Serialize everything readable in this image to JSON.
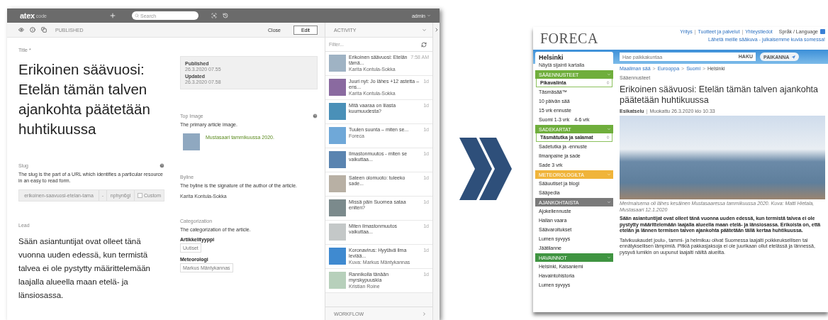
{
  "editor": {
    "topbar": {
      "logo": "atex",
      "logo_suffix": "code",
      "search_placeholder": "Search",
      "user": "admin"
    },
    "toolbar": {
      "status": "PUBLISHED",
      "close": "Close",
      "edit": "Edit"
    },
    "form": {
      "title_label": "Title",
      "required_mark": "*",
      "title": "Erikoinen säävuosi: Etelän tämän talven ajankohta päätetään huhtikuussa",
      "slug_label": "Slug",
      "slug_help": "The slug is the part of a URL which identifies a particular resource in an easy to read form.",
      "slug_value": "erikoinen-saavuosi-etelan-tama",
      "slug_separator": "-",
      "slug_suffix": "nphyn6gi",
      "custom_label": "Custom",
      "custom_checked": false,
      "lead_label": "Lead",
      "lead": "Sään asiantuntijat ovat olleet tänä vuonna uuden edessä, kun termistä talvea ei ole pystytty määrittelemään laajalla alueella maan etelä- ja länsiosassa."
    },
    "meta": {
      "published_label": "Published",
      "published": "26.3.2020 07.55",
      "updated_label": "Updated",
      "updated": "26.3.2020 07.58"
    },
    "top_image": {
      "label": "Top Image",
      "help": "The primary article image.",
      "caption": "Mustasaari tammikuussa 2020."
    },
    "byline": {
      "label": "Byline",
      "help": "The byline is the signature of the author of the article.",
      "value": "Karita Kontula-Sokka"
    },
    "categorization": {
      "label": "Categorization",
      "help": "The categorization of the article.",
      "fields": [
        {
          "label": "Artikkelityyppi",
          "value": "Uutiset"
        },
        {
          "label": "Meteorologi",
          "value": "Markus Mäntykannas"
        }
      ]
    },
    "activity": {
      "title": "ACTIVITY",
      "filter_placeholder": "Filter...",
      "footer": "WORKFLOW",
      "items": [
        {
          "title": "Erikoinen säävuosi: Etelän tämä...",
          "author": "Karita Kontula-Sokka",
          "time": "7:58 AM"
        },
        {
          "title": "Juuri nyt: Jo lähes +12 astetta – ens...",
          "author": "Karita Kontula-Sokka",
          "time": "1d"
        },
        {
          "title": "Mitä vaaraa on liiasta kuumuudesta?",
          "time": "1d"
        },
        {
          "title": "Tuulen suunta – miten se...",
          "author": "Foreca",
          "time": "1d"
        },
        {
          "title": "Ilmastonmuutos - miten se vaikuttaa...",
          "time": "1d"
        },
        {
          "title": "Sateen olomuoto: tuleeko sade...",
          "time": "1d"
        },
        {
          "title": "Missä päin Suomea sataa eniten?",
          "time": "1d"
        },
        {
          "title": "Miten ilmastonmuutos vaikuttaa...",
          "time": "1d"
        },
        {
          "title": "Koronavirus: Hyytävä ilma leviää...",
          "author": "Kuva: Markus Mäntykannas",
          "time": "1d"
        },
        {
          "title": "Rannikolla tänään myrskypuuskia",
          "author": "Kristian Roine",
          "time": "1d"
        }
      ]
    }
  },
  "site": {
    "logo": "FORECA",
    "top_links": [
      "Yritys",
      "Tuotteet ja palvelut",
      "Yhteystiedot"
    ],
    "link_separator": "|",
    "breadcrumb_separator": ">",
    "meta_separator": "|",
    "language": "Språk / Language",
    "send_photo": "Lähetä meille sääkuva - julkaisemme kuvia somessa!",
    "search_placeholder": "Hae paikkakuntaa",
    "search_button": "HAKU",
    "locate_button": "PAIKANNA",
    "city": "Helsinki",
    "show_map": "Näytä sijainti kartalla",
    "sections": [
      {
        "title": "SÄÄENNUSTEET",
        "color": "#6fae3c",
        "select": "Pikavalinta",
        "items": [
          {
            "label": "Täsmäsää™"
          },
          {
            "label": "10 päivän sää"
          },
          {
            "label": "15 vrk ennuste"
          },
          {
            "label": "Suomi 1-3 vrk",
            "extra": "4-6 vrk"
          }
        ]
      },
      {
        "title": "SADEKARTAT",
        "color": "#6fae3c",
        "select": "Täsmätutka ja salamat",
        "items": [
          {
            "label": "Sadetutka ja -ennuste"
          },
          {
            "label": "Ilmanpaine ja sade"
          },
          {
            "label": "Sade 3 vrk"
          }
        ]
      },
      {
        "title": "METEOROLOGILTA",
        "color": "#f0b43a",
        "items": [
          {
            "label": "Sääuutiset ja blogi"
          },
          {
            "label": "Sääpedia"
          }
        ]
      },
      {
        "title": "AJANKOHTAISTA",
        "color": "#7a7a7a",
        "items": [
          {
            "label": "Ajokeliennuste"
          },
          {
            "label": "Hallan vaara"
          },
          {
            "label": "Säävaroitukset"
          },
          {
            "label": "Lumen syvyys"
          },
          {
            "label": "Jäätilanne"
          }
        ]
      },
      {
        "title": "HAVAINNOT",
        "color": "#3f9441",
        "items": [
          {
            "label": "Helsinki, Kaisaniemi"
          },
          {
            "label": "Havaintohistoria"
          },
          {
            "label": "Lumen syvyys"
          }
        ]
      }
    ],
    "breadcrumb": [
      "Maailman sää",
      "Eurooppa",
      "Suomi",
      "Helsinki"
    ],
    "section": "Sääennusteet",
    "headline": "Erikoinen säävuosi: Etelän tämän talven ajankohta päätetään huhtikuussa",
    "meta_prefix": "Esikatselu",
    "meta": "Muokattu 26.3.2020 klo 10.33",
    "caption": "Merimaisema oli lähes kesäinen Mustasaaressa tammikuussa 2020. Kuva: Matti Hietala, Mustasaari 12.1.2020",
    "lead": "Sään asiantuntijat ovat olleet tänä vuonna uuden edessä, kun termistä talvea ei ole pystytty määrittelemään laajalla alueella maan etelä- ja länsiosassa. Erikoista on, että etelän ja lännen termisen talven ajankohta päätetään tällä kertaa huhtikuussa.",
    "body": "Talvikuukaudet joulu-, tammi- ja helmikuu olivat Suomessa laajalti poikkeuksellisen tai ennätyksellisen lämpimiä. Pitkiä pakkasjaksoja ei ole juurikaan ollut etelässä ja lännessä, pysyvä lumikin on uupunut laajalti näiltä alueilta."
  }
}
